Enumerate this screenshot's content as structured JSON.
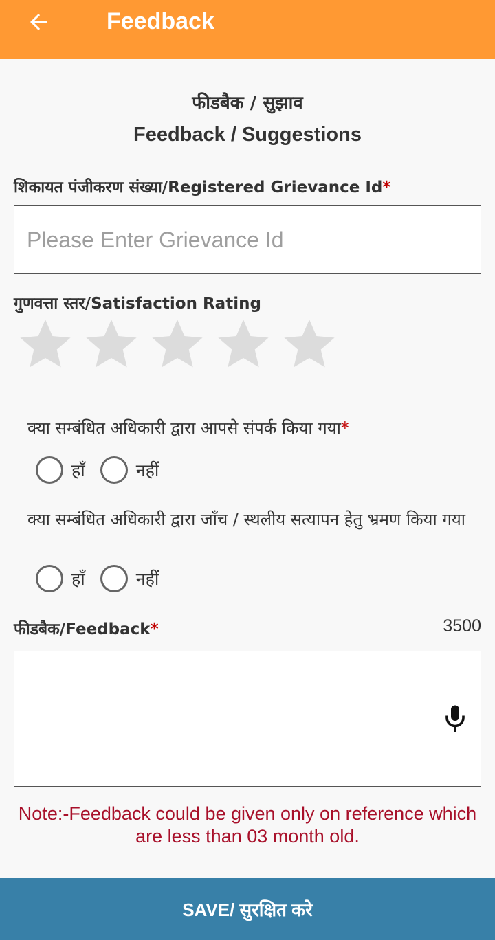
{
  "appbar": {
    "title": "Feedback",
    "background_color": "#ff9933",
    "back_icon": "arrow-back-icon"
  },
  "form": {
    "heading_hi": "फीडबैक / सुझाव",
    "heading_en": "Feedback / Suggestions",
    "grievance": {
      "label": "शिकायत पंजीकरण संख्या/Registered Grievance Id",
      "required_mark": "*",
      "value": "",
      "placeholder": "Please Enter Grievance Id"
    },
    "rating": {
      "label": "गुणवत्ता स्तर/Satisfaction Rating",
      "max_stars": 5,
      "selected": 0,
      "star_icon": "star-icon",
      "empty_color": "#dcdcdc"
    },
    "question1": {
      "text": "क्या सम्बंधित अधिकारी द्वारा आपसे संपर्क किया गया",
      "required_mark": "*",
      "options": [
        "हाँ",
        "नहीं"
      ],
      "selected": null
    },
    "question2": {
      "text": "क्या सम्बंधित अधिकारी द्वारा जाँच / स्थलीय सत्यापन हेतु भ्रमण किया गया",
      "options": [
        "हाँ",
        "नहीं"
      ],
      "selected": null
    },
    "feedback": {
      "label": "फीडबैक/Feedback",
      "required_mark": "*",
      "counter": "3500",
      "value": "",
      "mic_icon": "microphone-icon"
    },
    "note": "Note:-Feedback could be given only on reference which are less than 03 month old.",
    "note_color": "#a8102a"
  },
  "footer": {
    "save_label": "SAVE/ सुरक्षित करे",
    "save_color": "#3880a8"
  }
}
